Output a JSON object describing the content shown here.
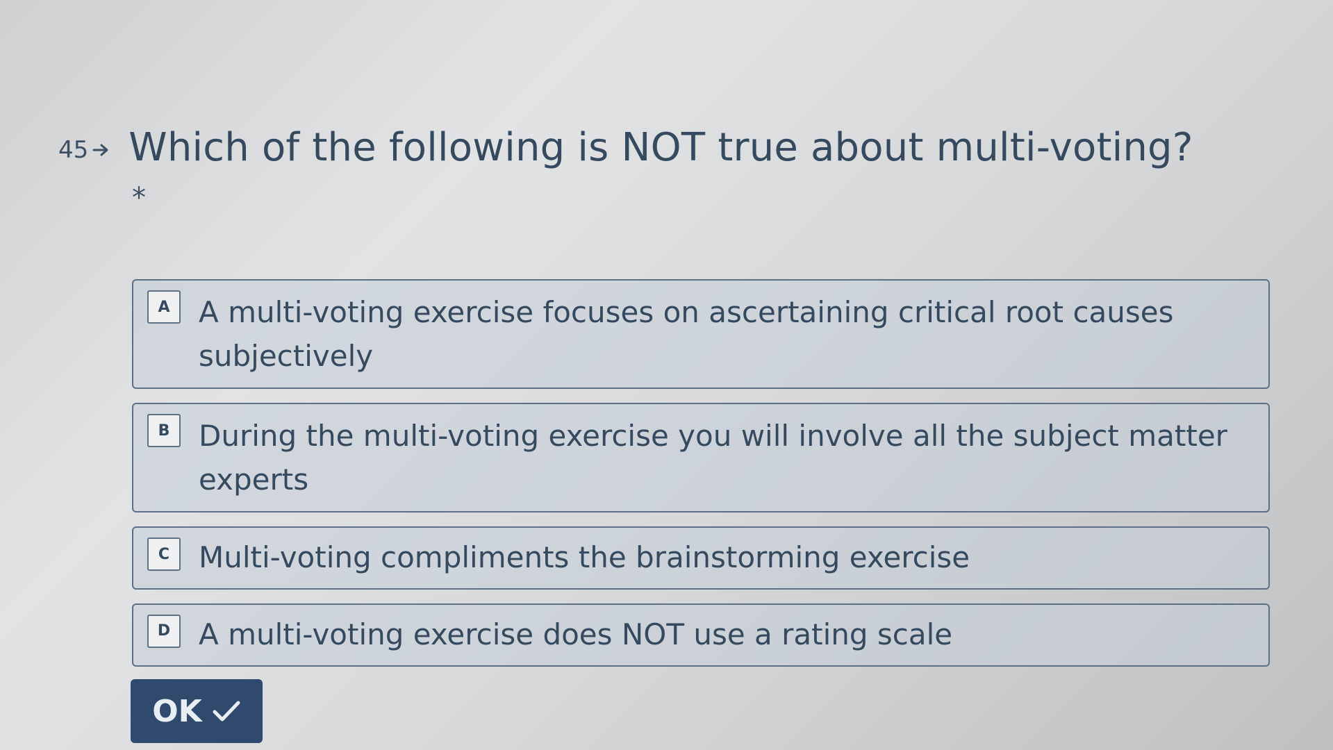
{
  "question": {
    "number": "45",
    "number_icon": "arrow-right-icon",
    "title": "Which of the following is NOT true about multi-voting?",
    "required_marker": "*"
  },
  "choices": [
    {
      "key": "A",
      "text": "A multi-voting exercise focuses on ascertaining critical root causes subjectively"
    },
    {
      "key": "B",
      "text": "During the multi-voting exercise you will involve all the subject matter experts"
    },
    {
      "key": "C",
      "text": "Multi-voting compliments the brainstorming exercise"
    },
    {
      "key": "D",
      "text": "A multi-voting exercise does NOT use a rating scale"
    }
  ],
  "ok_button": {
    "label": "OK",
    "icon": "checkmark-icon"
  },
  "colors": {
    "text": "#35495f",
    "border": "#5c6f84",
    "choice_background": "#c4cdd8",
    "button_background": "#2f4a6c",
    "button_text": "#e9eef4"
  }
}
